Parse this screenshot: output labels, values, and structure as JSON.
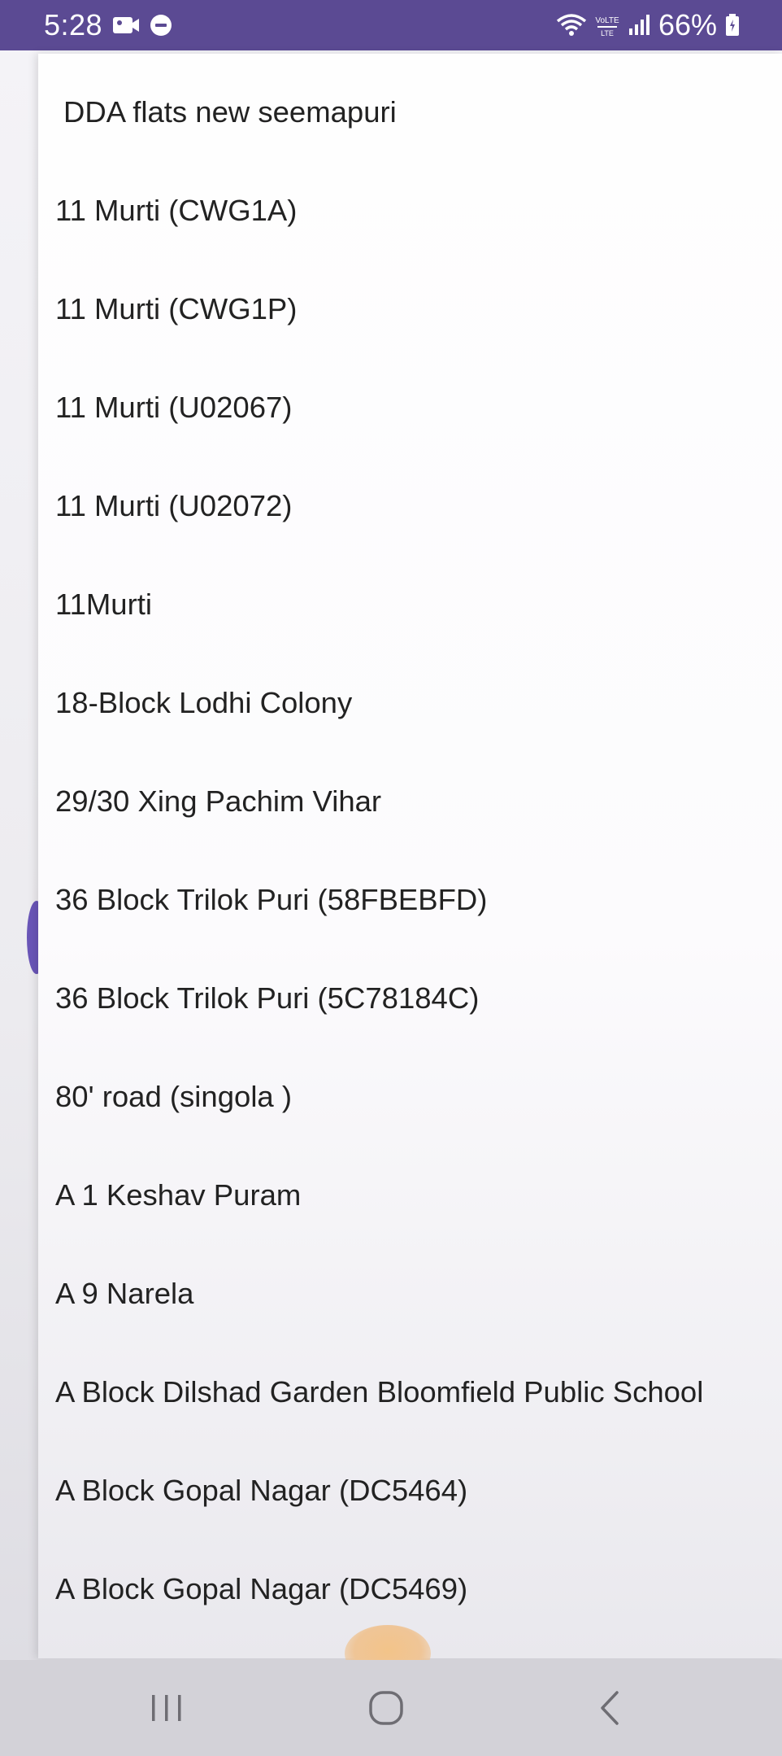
{
  "status_bar": {
    "time": "5:28",
    "battery": "66%",
    "network": "VoLTE"
  },
  "dropdown": {
    "items": [
      "DDA flats new seemapuri",
      "11 Murti (CWG1A)",
      "11 Murti (CWG1P)",
      "11 Murti (U02067)",
      "11 Murti (U02072)",
      "11Murti",
      "18-Block Lodhi Colony",
      "29/30 Xing Pachim Vihar",
      "36 Block Trilok Puri (58FBEBFD)",
      "36 Block Trilok Puri (5C78184C)",
      "80' road (singola  )",
      "A 1 Keshav Puram",
      "A 9 Narela",
      "A Block Dilshad Garden Bloomfield Public School",
      "A Block Gopal Nagar (DC5464)",
      "A Block Gopal Nagar (DC5469)"
    ]
  },
  "navigation_bar": {
    "recents_icon": "recents-icon",
    "home_icon": "home-icon",
    "back_icon": "back-icon"
  },
  "colors": {
    "status_bar": "#5b4a93",
    "accent": "#6a56b8",
    "text": "#222222"
  }
}
